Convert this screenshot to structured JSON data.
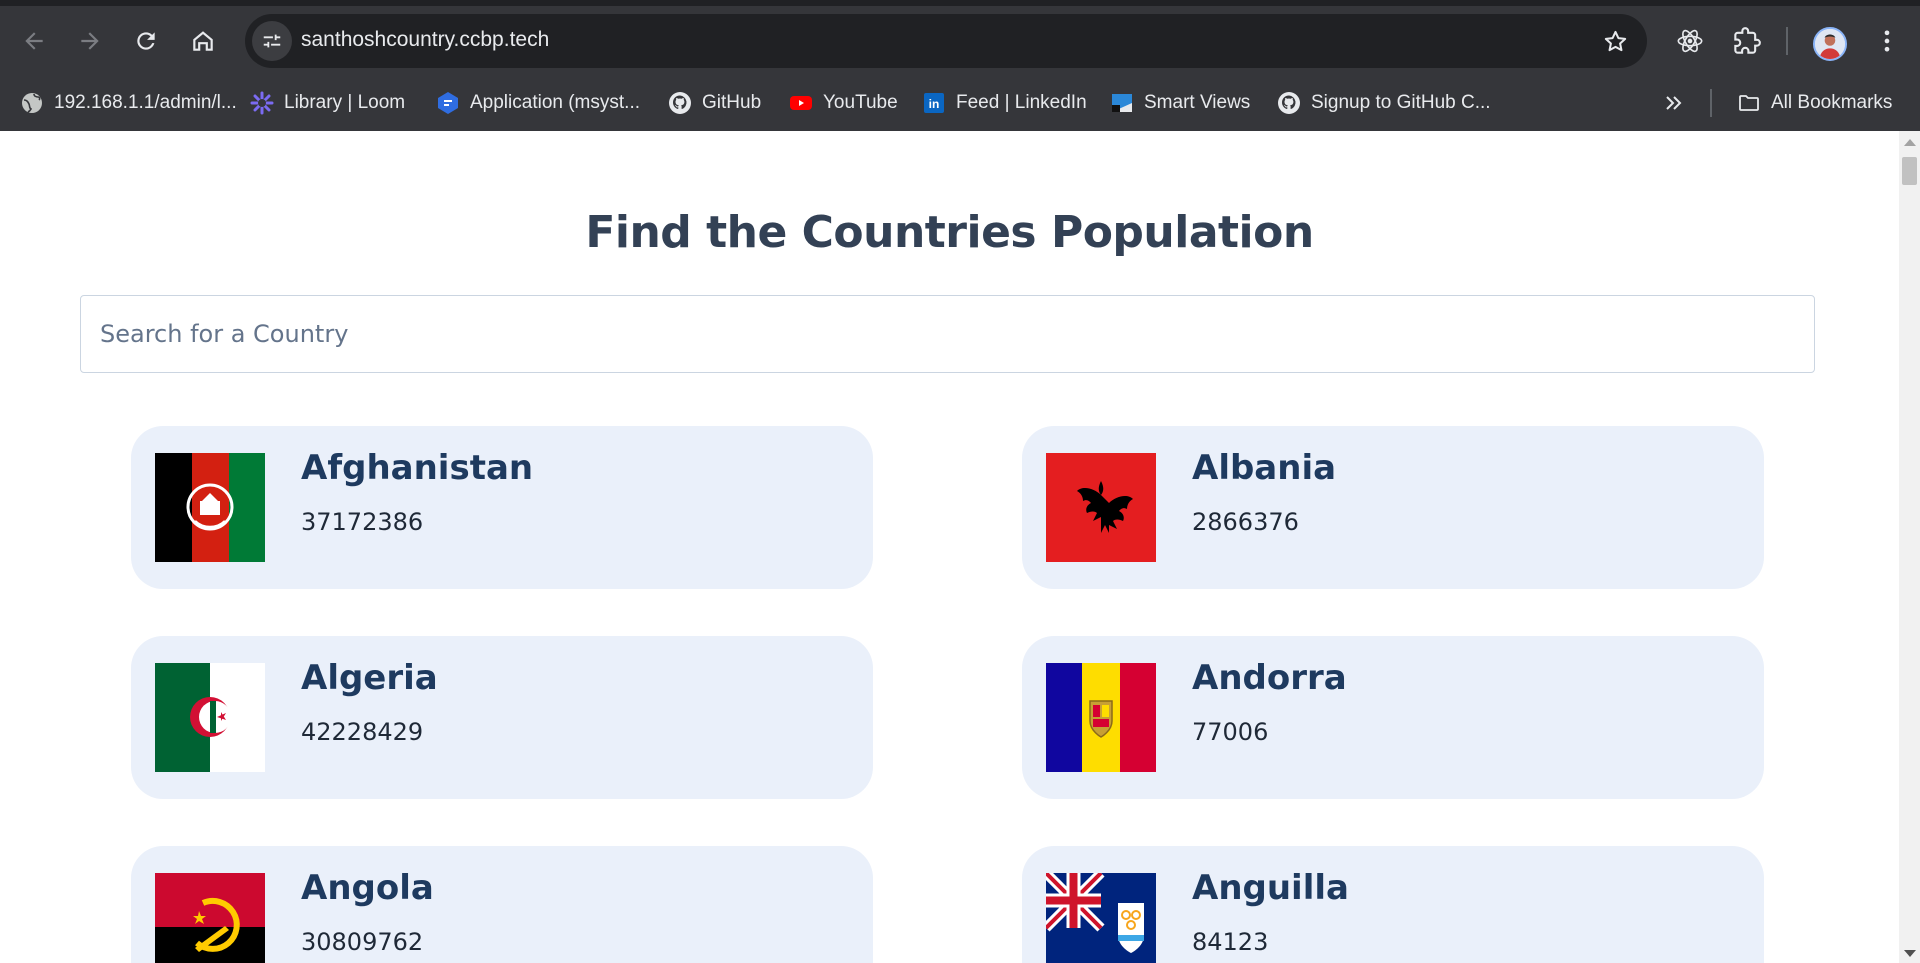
{
  "browser": {
    "url": "santhoshcountry.ccbp.tech",
    "bookmarks": [
      {
        "label": "192.168.1.1/admin/l...",
        "icon": "globe-icon"
      },
      {
        "label": "Library | Loom",
        "icon": "loom-icon"
      },
      {
        "label": "Application (msyst...",
        "icon": "app-icon"
      },
      {
        "label": "GitHub",
        "icon": "github-icon"
      },
      {
        "label": "YouTube",
        "icon": "youtube-icon"
      },
      {
        "label": "Feed | LinkedIn",
        "icon": "linkedin-icon"
      },
      {
        "label": "Smart Views",
        "icon": "smart-views-icon"
      },
      {
        "label": "Signup to GitHub C...",
        "icon": "github-icon"
      }
    ],
    "all_bookmarks_label": "All Bookmarks"
  },
  "page": {
    "title": "Find the Countries Population",
    "search_placeholder": "Search for a Country",
    "search_value": ""
  },
  "countries": [
    {
      "name": "Afghanistan",
      "population": "37172386",
      "flag": "afghanistan-flag"
    },
    {
      "name": "Albania",
      "population": "2866376",
      "flag": "albania-flag"
    },
    {
      "name": "Algeria",
      "population": "42228429",
      "flag": "algeria-flag"
    },
    {
      "name": "Andorra",
      "population": "77006",
      "flag": "andorra-flag"
    },
    {
      "name": "Angola",
      "population": "30809762",
      "flag": "angola-flag"
    },
    {
      "name": "Anguilla",
      "population": "84123",
      "flag": "anguilla-flag"
    }
  ],
  "colors": {
    "title": "#334155",
    "card_bg": "#eaf0fa",
    "country_name": "#1e3a5f",
    "chrome_bg": "#35363a",
    "omnibox_bg": "#202124"
  }
}
